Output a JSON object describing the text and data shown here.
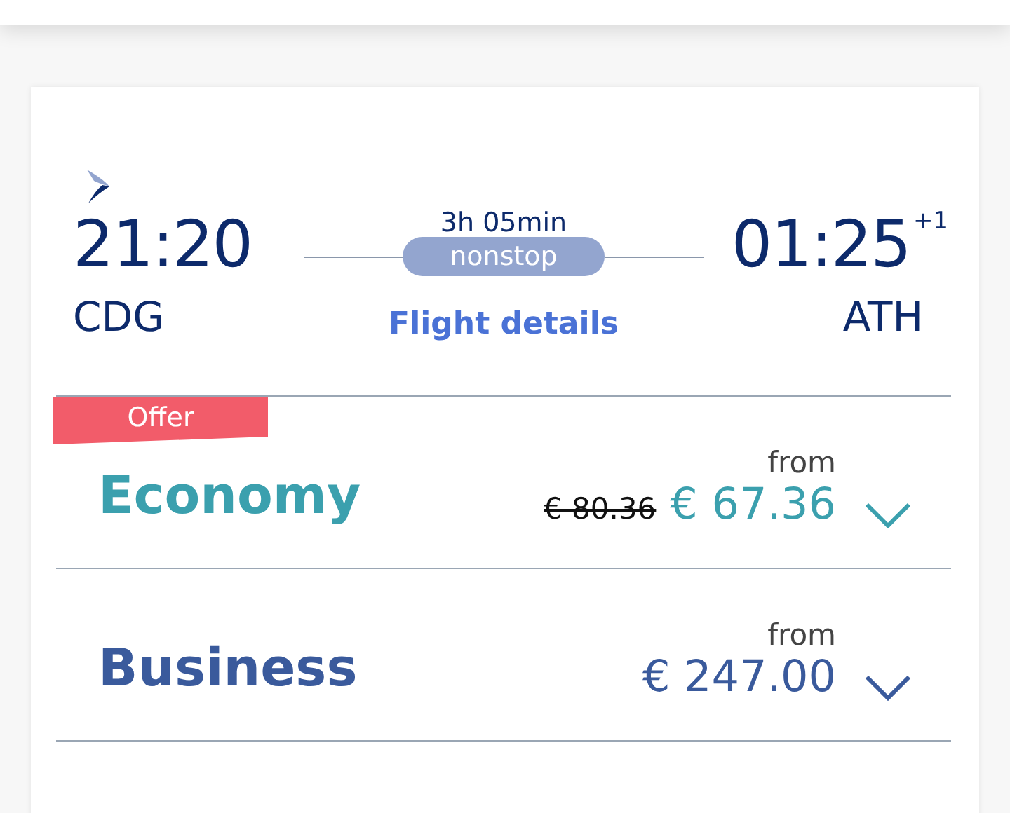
{
  "flight": {
    "departure_time": "21:20",
    "departure_airport": "CDG",
    "duration": "3h 05min",
    "stops": "nonstop",
    "details_link": "Flight details",
    "arrival_time": "01:25",
    "day_offset": "+1",
    "arrival_airport": "ATH"
  },
  "fares": [
    {
      "badge": "Offer",
      "name": "Economy",
      "color": "#3ba0ae",
      "from_label": "from",
      "old_price": "€ 80.36",
      "price": "€ 67.36",
      "expanded": false
    },
    {
      "name": "Business",
      "color": "#3a5a9c",
      "from_label": "from",
      "price": "€ 247.00",
      "expanded": false
    }
  ]
}
